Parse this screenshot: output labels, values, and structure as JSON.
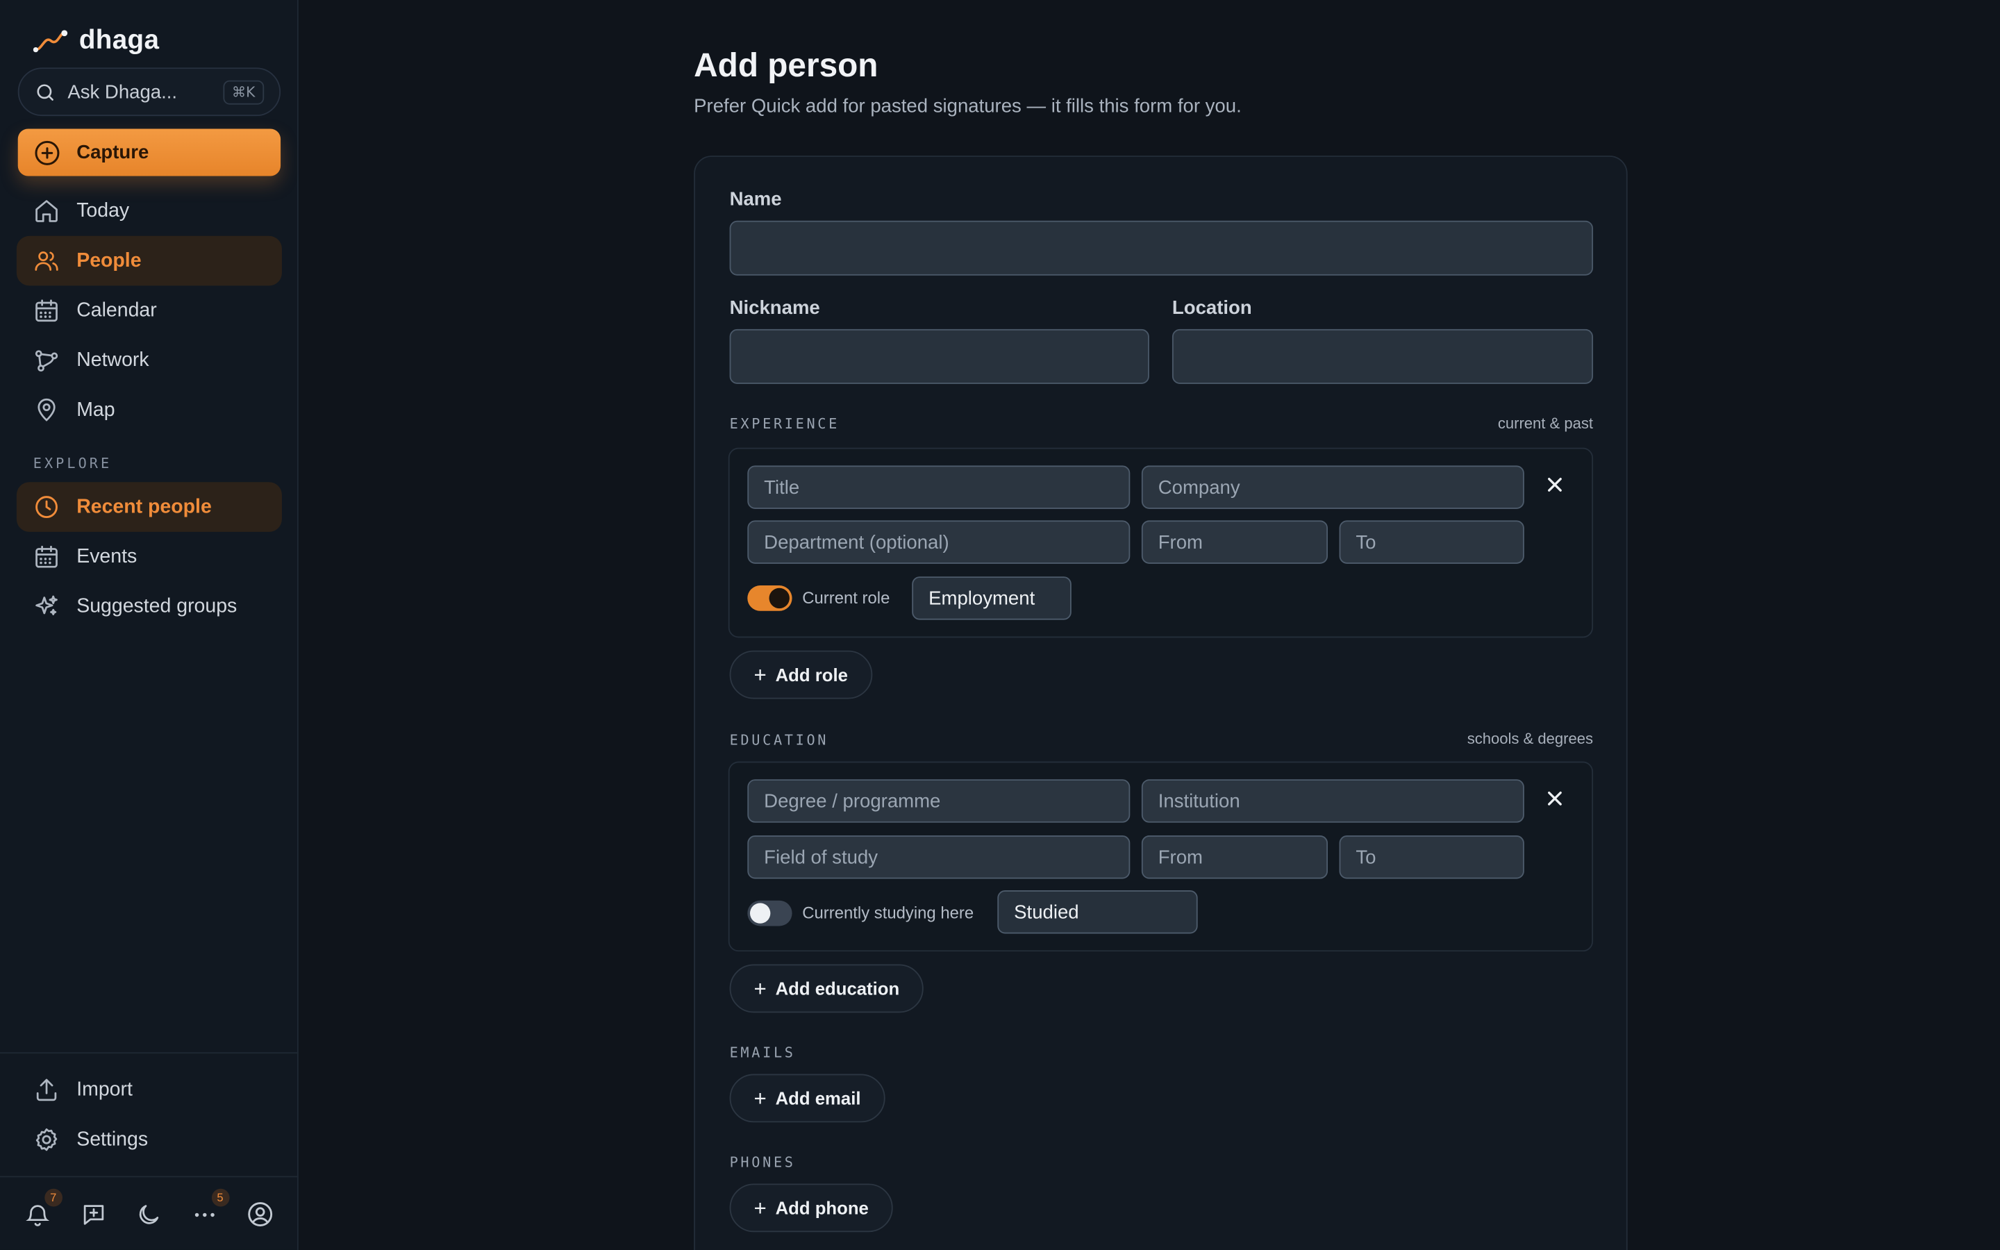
{
  "brand": {
    "name": "dhaga"
  },
  "search": {
    "placeholder": "Ask Dhaga...",
    "shortcut": "⌘K"
  },
  "capture": {
    "label": "Capture"
  },
  "nav": {
    "primary": [
      {
        "label": "Today",
        "icon": "home-icon"
      },
      {
        "label": "People",
        "icon": "users-icon",
        "active": true
      },
      {
        "label": "Calendar",
        "icon": "calendar-icon"
      },
      {
        "label": "Network",
        "icon": "network-icon"
      },
      {
        "label": "Map",
        "icon": "map-pin-icon"
      }
    ],
    "explore_label": "EXPLORE",
    "explore": [
      {
        "label": "Recent people",
        "icon": "clock-icon",
        "active": true
      },
      {
        "label": "Events",
        "icon": "calendar-icon"
      },
      {
        "label": "Suggested groups",
        "icon": "sparkles-icon"
      }
    ],
    "bottom": [
      {
        "label": "Import",
        "icon": "upload-icon"
      },
      {
        "label": "Settings",
        "icon": "gear-icon"
      }
    ]
  },
  "footer": {
    "notifications_badge": "7",
    "more_badge": "5"
  },
  "page": {
    "title": "Add person",
    "subtitle": "Prefer Quick add for pasted signatures — it fills this form for you."
  },
  "form": {
    "name_label": "Name",
    "nickname_label": "Nickname",
    "location_label": "Location",
    "experience": {
      "heading": "EXPERIENCE",
      "hint": "current & past",
      "title_placeholder": "Title",
      "company_placeholder": "Company",
      "department_placeholder": "Department (optional)",
      "from_placeholder": "From",
      "to_placeholder": "To",
      "current_label": "Current role",
      "current_on": true,
      "type_value": "Employment",
      "add_label": "Add role"
    },
    "education": {
      "heading": "EDUCATION",
      "hint": "schools & degrees",
      "degree_placeholder": "Degree / programme",
      "institution_placeholder": "Institution",
      "field_placeholder": "Field of study",
      "from_placeholder": "From",
      "to_placeholder": "To",
      "current_label": "Currently studying here",
      "current_on": false,
      "type_value": "Studied",
      "add_label": "Add education"
    },
    "emails": {
      "heading": "EMAILS",
      "add_label": "Add email"
    },
    "phones": {
      "heading": "PHONES",
      "add_label": "Add phone"
    }
  },
  "colors": {
    "accent": "#f08c3a",
    "background": "#0f141b",
    "sidebar": "#111821"
  }
}
